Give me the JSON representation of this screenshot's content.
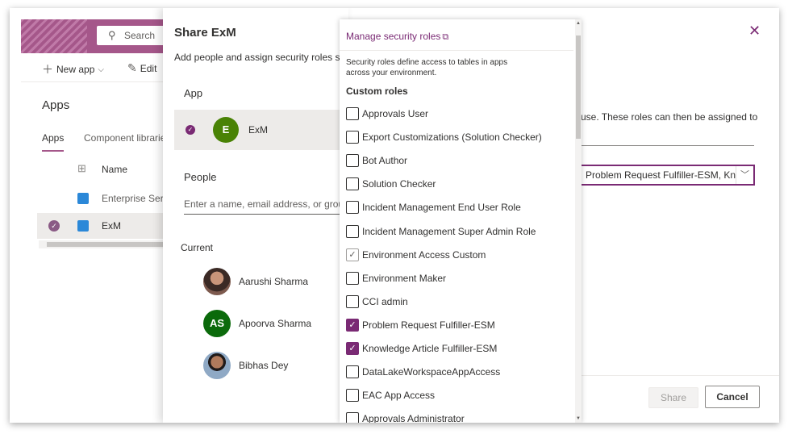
{
  "background": {
    "search_placeholder": "Search",
    "commands": {
      "new_app": "New app",
      "edit": "Edit"
    },
    "page_title": "Apps",
    "tabs": [
      "Apps",
      "Component libraries"
    ],
    "column_name": "Name",
    "rows": [
      "Enterprise Servi",
      "ExM"
    ],
    "right_text": "use. These roles can then be assigned to",
    "selected_roles_value": "Problem Request Fulfiller-ESM, Know",
    "close_glyph": "✕",
    "share_button": "Share",
    "cancel_button": "Cancel"
  },
  "share_panel": {
    "title": "Share ExM",
    "subtitle": "Add people and assign security roles so th",
    "app_label": "App",
    "app": {
      "initial": "E",
      "name": "ExM",
      "color": "#498205"
    },
    "people_label": "People",
    "people_placeholder": "Enter a name, email address, or group",
    "current_label": "Current",
    "people": [
      {
        "name": "Aarushi Sharma",
        "initials": "",
        "avatar": "photo"
      },
      {
        "name": "Apoorva Sharma",
        "initials": "AS",
        "avatar": "initials"
      },
      {
        "name": "Bibhas Dey",
        "initials": "",
        "avatar": "photo"
      }
    ]
  },
  "roles_dropdown": {
    "manage_link": "Manage security roles",
    "help_text": "Security roles define access to tables in apps across your environment.",
    "group_label": "Custom roles",
    "roles": [
      {
        "label": "Approvals User",
        "checked": false
      },
      {
        "label": "Export Customizations (Solution Checker)",
        "checked": false
      },
      {
        "label": "Bot Author",
        "checked": false
      },
      {
        "label": "Solution Checker",
        "checked": false
      },
      {
        "label": "Incident Management End User Role",
        "checked": false
      },
      {
        "label": "Incident Management Super Admin Role",
        "checked": false
      },
      {
        "label": "Environment Access Custom",
        "checked": "disabled"
      },
      {
        "label": "Environment Maker",
        "checked": false
      },
      {
        "label": "CCI admin",
        "checked": false
      },
      {
        "label": "Problem Request Fulfiller-ESM",
        "checked": true
      },
      {
        "label": "Knowledge Article Fulfiller-ESM",
        "checked": true
      },
      {
        "label": "DataLakeWorkspaceAppAccess",
        "checked": false
      },
      {
        "label": "EAC App Access",
        "checked": false
      },
      {
        "label": "Approvals Administrator",
        "checked": false
      }
    ],
    "accent": "#7a2a74"
  }
}
